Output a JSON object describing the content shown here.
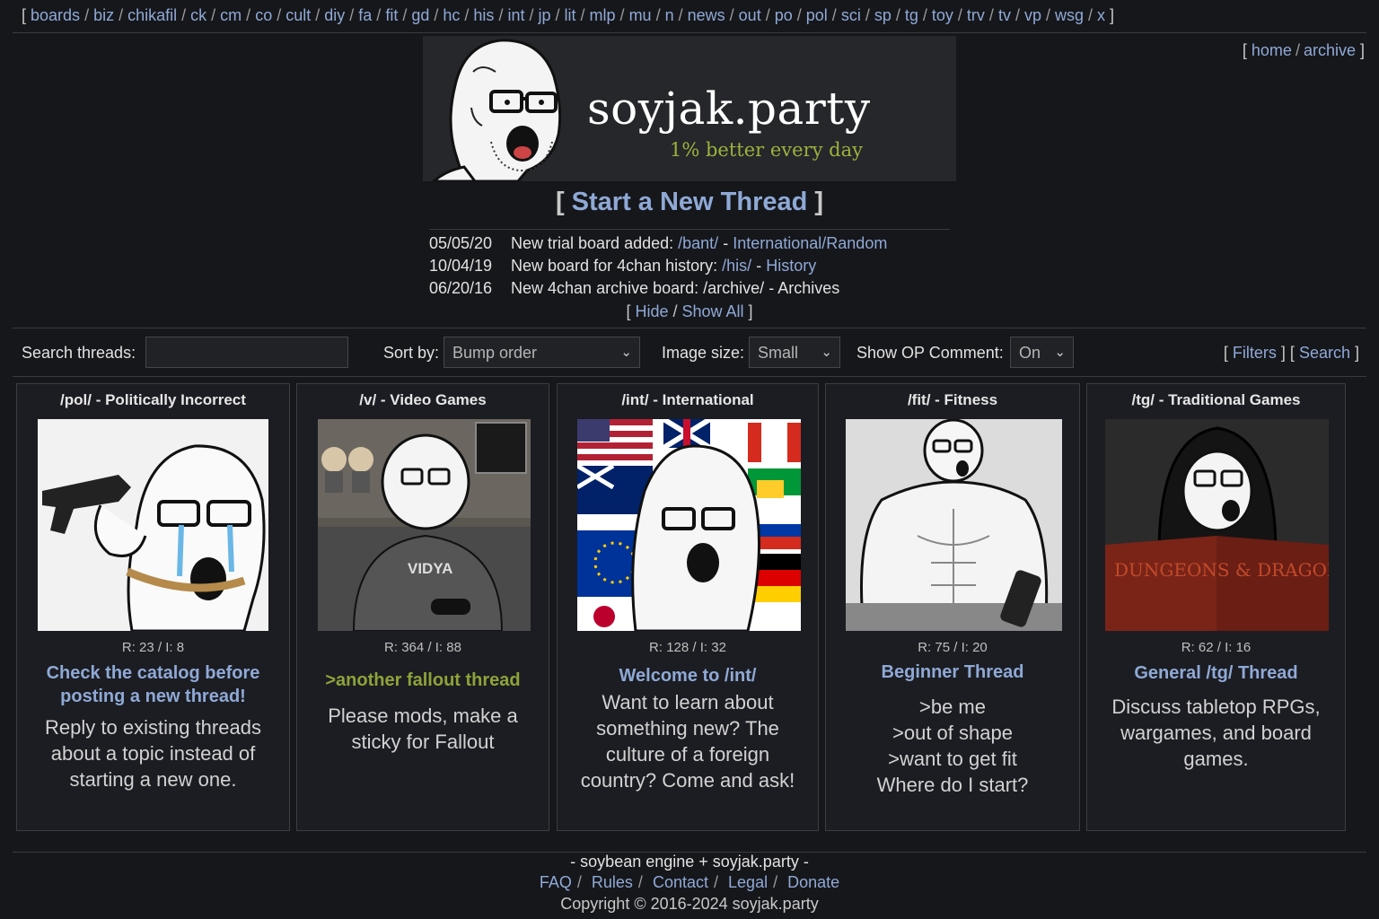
{
  "topnav": {
    "boards_label": "boards",
    "boards": [
      "biz",
      "chikafil",
      "ck",
      "cm",
      "co",
      "cult",
      "diy",
      "fa",
      "fit",
      "gd",
      "hc",
      "his",
      "int",
      "jp",
      "lit",
      "mlp",
      "mu",
      "n",
      "news",
      "out",
      "po",
      "pol",
      "sci",
      "sp",
      "tg",
      "toy",
      "trv",
      "tv",
      "vp",
      "wsg",
      "x"
    ]
  },
  "toplinks": {
    "home": "home",
    "archive": "archive"
  },
  "banner": {
    "title": "soyjak.party",
    "tagline": "1% better every day"
  },
  "new_thread": {
    "label": "Start a New Thread"
  },
  "news": [
    {
      "date": "05/05/20",
      "text": "New trial board added:",
      "board": "/bant/",
      "desc": "International/Random",
      "linked": true
    },
    {
      "date": "10/04/19",
      "text": "New board for 4chan history:",
      "board": "/his/",
      "desc": "History",
      "linked": true
    },
    {
      "date": "06/20/16",
      "text": "New 4chan archive board:",
      "board": "/archive/",
      "desc": "Archives",
      "linked": false
    }
  ],
  "news_toggle": {
    "hide": "Hide",
    "show_all": "Show All"
  },
  "toolbar": {
    "search_label": "Search threads:",
    "search_value": "",
    "sort_label": "Sort by:",
    "sort_value": "Bump order",
    "image_size_label": "Image size:",
    "image_size_value": "Small",
    "op_comment_label": "Show OP Comment:",
    "op_comment_value": "On",
    "filters": "Filters",
    "search": "Search"
  },
  "cards": [
    {
      "title": "/pol/ - Politically Incorrect",
      "stats": "R: 23 / I: 8",
      "subject": "Check the catalog before posting a new thread!",
      "subject_color": "blue",
      "comment": "Reply to existing threads about a topic instead of starting a new one."
    },
    {
      "title": "/v/ - Video Games",
      "stats": "R: 364 / I: 88",
      "subject": ">another fallout thread",
      "subject_color": "green",
      "comment": "Please mods, make a sticky for Fallout",
      "shirt_text": "VIDYA"
    },
    {
      "title": "/int/ - International",
      "stats": "R: 128 / I: 32",
      "subject": "Welcome to /int/",
      "subject_color": "blue",
      "comment": "Want to learn about something new? The culture of a foreign country? Come and ask!"
    },
    {
      "title": "/fit/ - Fitness",
      "stats": "R: 75 / I: 20",
      "subject": "Beginner Thread",
      "subject_color": "blue",
      "comment_lines": [
        ">be me",
        ">out of shape",
        ">want to get fit",
        "Where do I start?"
      ]
    },
    {
      "title": "/tg/ - Traditional Games",
      "stats": "R: 62 / I: 16",
      "subject": "General /tg/ Thread",
      "subject_color": "blue",
      "comment": "Discuss tabletop RPGs, wargames, and board games.",
      "book_text": "DUNGEONS & DRAGONS"
    }
  ],
  "footer": {
    "engine": "- soybean engine + soyjak.party -",
    "links": [
      "FAQ",
      "Rules",
      "Contact",
      "Legal",
      "Donate"
    ],
    "copyright": "Copyright © 2016-2024 soyjak.party"
  }
}
